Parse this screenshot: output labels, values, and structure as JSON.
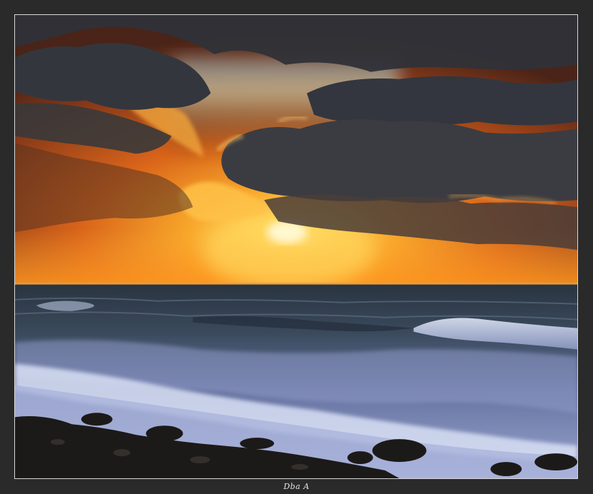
{
  "photo": {
    "subject": "sunset-over-sea",
    "colors": {
      "frame": "#2a2a2a",
      "border": "#d8d8d8",
      "sun": "#ffe27a",
      "sky_orange": "#f08a1c",
      "cloud_dark": "#2f3138",
      "sea": "#3b4a5a",
      "foam": "#d9e2f2",
      "rocks": "#1c1a18"
    }
  },
  "caption": {
    "signature": "Dba A"
  }
}
